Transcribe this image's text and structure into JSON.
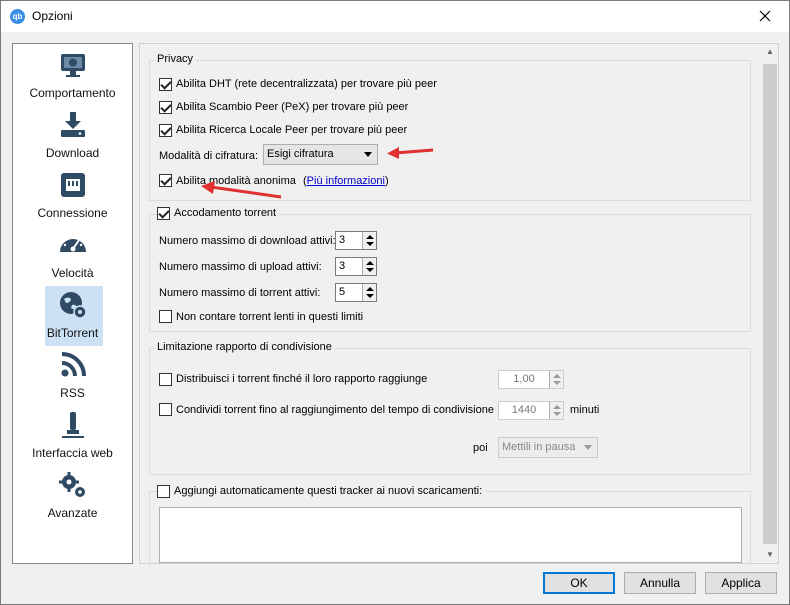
{
  "window": {
    "title": "Opzioni",
    "app_icon": "qb"
  },
  "sidebar": {
    "items": [
      {
        "label": "Comportamento",
        "icon": "monitor-icon"
      },
      {
        "label": "Download",
        "icon": "download-icon"
      },
      {
        "label": "Connessione",
        "icon": "network-icon"
      },
      {
        "label": "Velocità",
        "icon": "speedometer-icon"
      },
      {
        "label": "BitTorrent",
        "icon": "globe-gear-icon",
        "selected": true
      },
      {
        "label": "RSS",
        "icon": "rss-icon"
      },
      {
        "label": "Interfaccia web",
        "icon": "web-ui-icon"
      },
      {
        "label": "Avanzate",
        "icon": "gears-icon"
      }
    ]
  },
  "privacy": {
    "title": "Privacy",
    "dht_label": "Abilita DHT (rete decentralizzata) per trovare più peer",
    "pex_label": "Abilita Scambio Peer (PeX) per trovare più peer",
    "lsd_label": "Abilita Ricerca Locale Peer per trovare più peer",
    "encryption_label": "Modalità di cifratura:",
    "encryption_value": "Esigi cifratura",
    "anon_label": "Abilita modalità anonima",
    "anon_link_open": "(",
    "anon_link": "Più informazioni",
    "anon_link_close": ")"
  },
  "queue": {
    "title": "Accodamento torrent",
    "max_downloads_label": "Numero massimo di download attivi:",
    "max_downloads": "3",
    "max_uploads_label": "Numero massimo di upload attivi:",
    "max_uploads": "3",
    "max_torrents_label": "Numero massimo di torrent attivi:",
    "max_torrents": "5",
    "slow_label": "Non contare torrent lenti in questi limiti"
  },
  "ratio": {
    "title": "Limitazione rapporto di condivisione",
    "ratio_label": "Distribuisci i torrent finché il loro rapporto raggiunge",
    "ratio_value": "1,00",
    "time_label": "Condividi torrent fino al raggiungimento del tempo di condivisione",
    "time_value": "1440",
    "time_unit": "minuti",
    "then_label": "poi",
    "then_value": "Mettili in pausa"
  },
  "trackers": {
    "label": "Aggiungi automaticamente questi tracker ai nuovi scaricamenti:"
  },
  "buttons": {
    "ok": "OK",
    "cancel": "Annulla",
    "apply": "Applica"
  },
  "colors": {
    "selection": "#cde1f5",
    "link": "#0000cc",
    "annotation_arrow": "#e03030",
    "accent": "#0078d7"
  }
}
